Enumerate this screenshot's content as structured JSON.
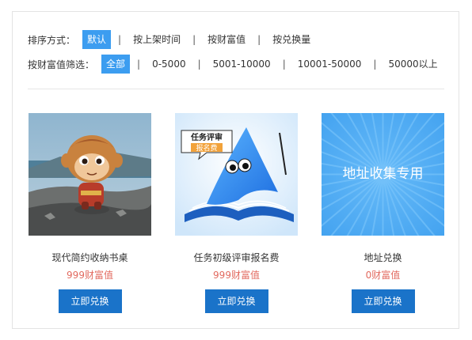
{
  "sort": {
    "label": "排序方式：",
    "options": [
      "默认",
      "按上架时间",
      "按财富值",
      "按兑换量"
    ],
    "active_index": 0
  },
  "filter": {
    "label": "按财富值筛选：",
    "options": [
      "全部",
      "0-5000",
      "5001-10000",
      "10001-50000",
      "50000以上"
    ],
    "active_index": 0
  },
  "products": [
    {
      "name": "现代简约收纳书桌",
      "price": "999财富值",
      "button": "立即兑换",
      "image_text": []
    },
    {
      "name": "任务初级评审报名费",
      "price": "999财富值",
      "button": "立即兑换",
      "image_text": [
        "任务评审",
        "报名费"
      ]
    },
    {
      "name": "地址兑换",
      "price": "0财富值",
      "button": "立即兑换",
      "image_text": [
        "地址收集专用"
      ]
    }
  ],
  "colors": {
    "accent": "#3c9df0",
    "button": "#1a73c9",
    "price": "#e26a5f"
  }
}
